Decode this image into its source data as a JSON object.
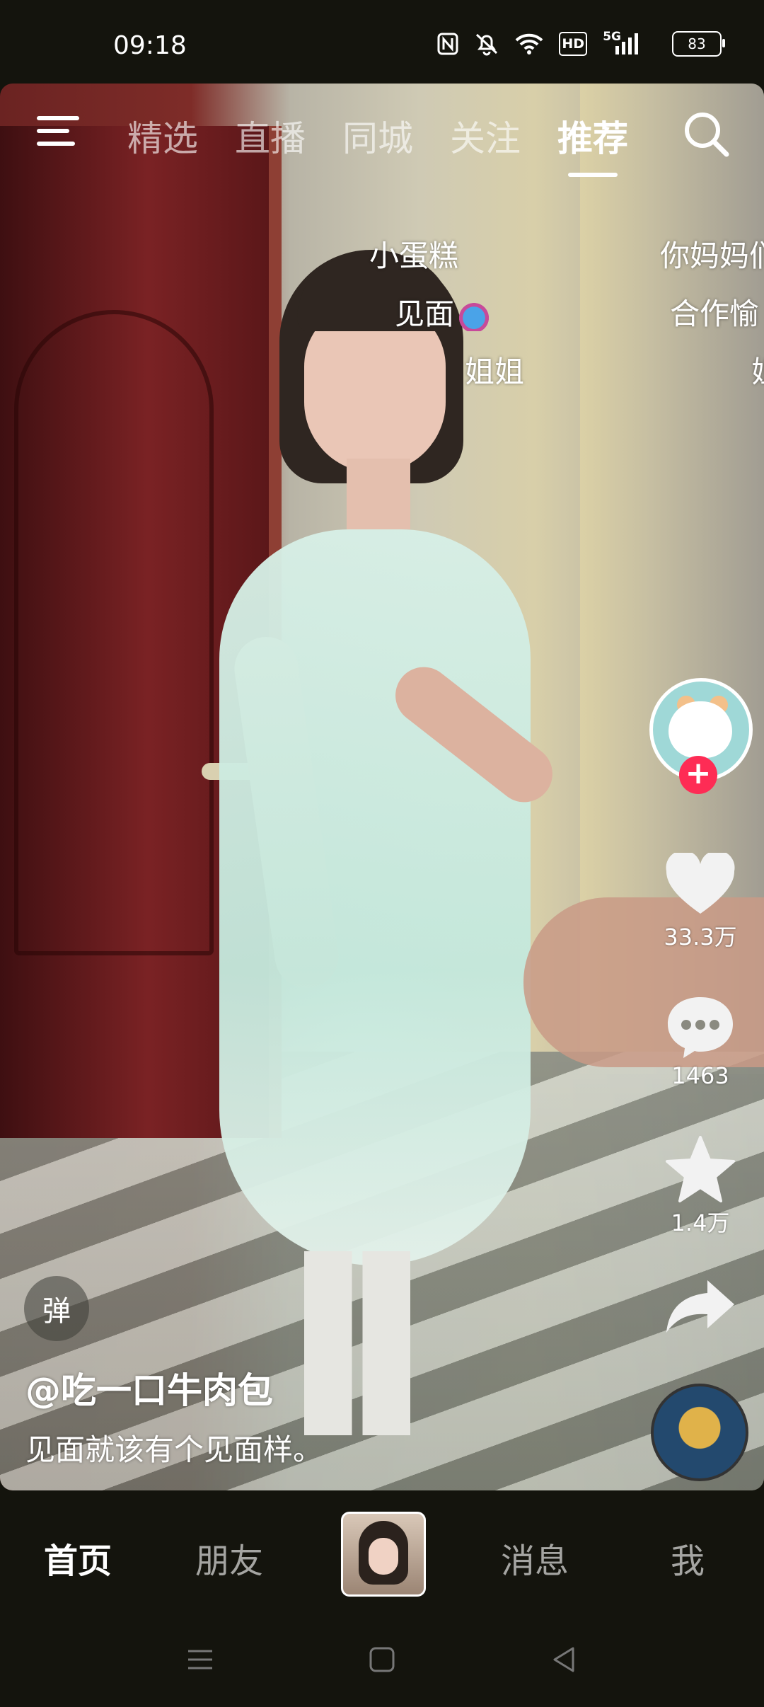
{
  "status_bar": {
    "time": "09:18",
    "icons": [
      "nfc-icon",
      "mute-icon",
      "wifi-icon",
      "hd-icon",
      "5g-signal-icon",
      "battery-icon"
    ],
    "hd_label": "HD",
    "network_label": "5G",
    "battery_level": "83"
  },
  "top_nav": {
    "tabs": [
      {
        "label": "精选",
        "active": false
      },
      {
        "label": "直播",
        "active": false
      },
      {
        "label": "同城",
        "active": false
      },
      {
        "label": "关注",
        "active": false
      },
      {
        "label": "推荐",
        "active": true
      }
    ]
  },
  "danmaku": [
    {
      "text": "小蛋糕"
    },
    {
      "text": "见面"
    },
    {
      "text": "姐姐"
    },
    {
      "text": "你妈妈们"
    },
    {
      "text": "合作愉"
    },
    {
      "text": "姐"
    }
  ],
  "right_rail": {
    "like_count": "33.3万",
    "comment_count": "1463",
    "favorite_count": "1.4万",
    "follow_symbol": "+"
  },
  "video_info": {
    "danmu_toggle": "弹",
    "author": "@吃一口牛肉包",
    "caption": "见面就该有个见面样。"
  },
  "bottom_tabs": [
    {
      "label": "首页",
      "active": true
    },
    {
      "label": "朋友",
      "active": false
    },
    {
      "label": "消息",
      "active": false
    },
    {
      "label": "我",
      "active": false
    }
  ],
  "colors": {
    "background": "#14140d",
    "accent": "#fe2c55"
  }
}
